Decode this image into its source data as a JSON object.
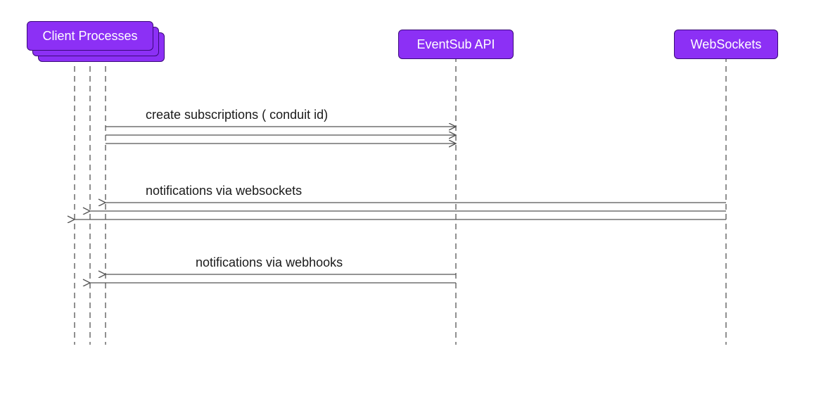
{
  "chart_data": {
    "type": "sequence_diagram",
    "participants": [
      {
        "id": "client",
        "label": "Client Processes",
        "multi_instance": true,
        "lifeline_count": 3
      },
      {
        "id": "eventsub",
        "label": "EventSub API",
        "multi_instance": false,
        "lifeline_count": 1
      },
      {
        "id": "websockets",
        "label": "WebSockets",
        "multi_instance": false,
        "lifeline_count": 1
      }
    ],
    "messages": [
      {
        "from": "client",
        "to": "eventsub",
        "label": "create subscriptions ( conduit id)",
        "direction": "right",
        "count": 3
      },
      {
        "from": "websockets",
        "to": "client",
        "label": "notifications via websockets",
        "direction": "left",
        "count": 3
      },
      {
        "from": "eventsub",
        "to": "client",
        "label": "notifications via webhooks",
        "direction": "left",
        "count": 2
      }
    ]
  },
  "actors": {
    "client": "Client Processes",
    "eventsub": "EventSub API",
    "websockets": "WebSockets"
  },
  "labels": {
    "msg1": "create subscriptions ( conduit id)",
    "msg2": "notifications via websockets",
    "msg3": "notifications via webhooks"
  },
  "colors": {
    "actor_fill": "#8c30f5",
    "actor_border": "#3b0a7a",
    "text_on_actor": "#ffffff",
    "line": "#555555",
    "label": "#1a1a1a"
  }
}
